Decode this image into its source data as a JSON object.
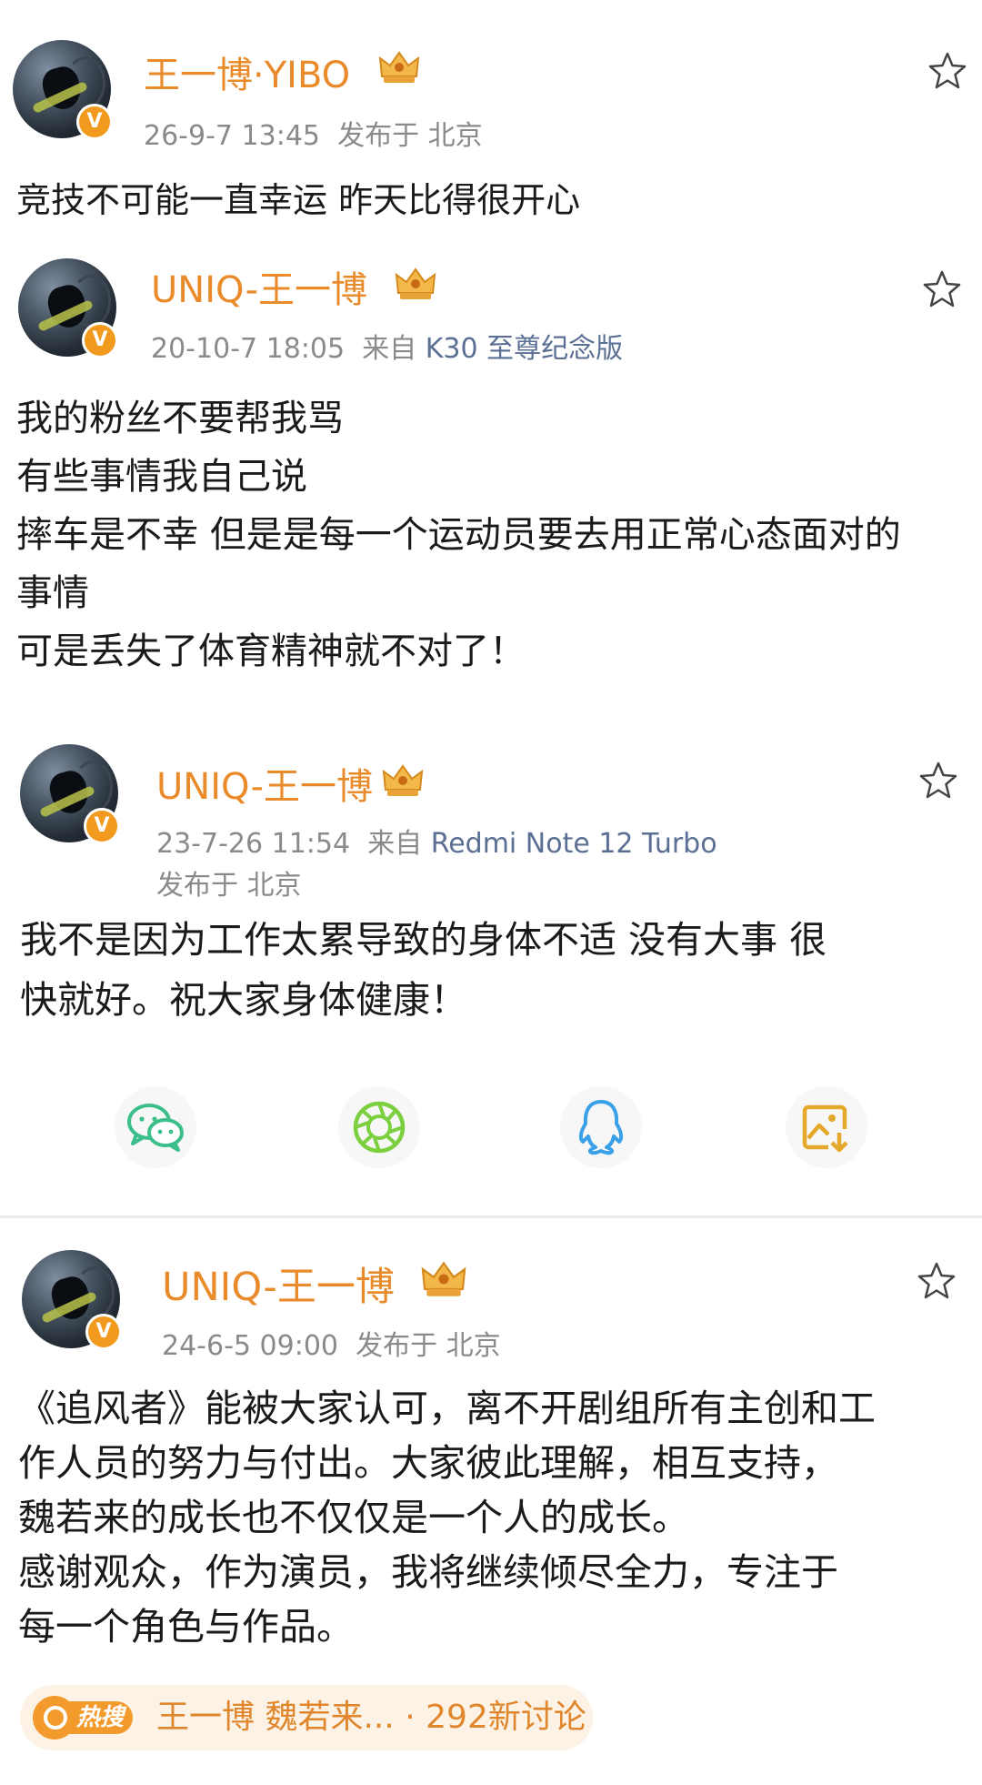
{
  "posts": [
    {
      "username": "王一博·YIBO",
      "time": "26-9-7 13:45",
      "source": "发布于 北京",
      "lines": [
        "竞技不可能一直幸运 昨天比得很开心"
      ]
    },
    {
      "username": "UNIQ-王一博",
      "time": "20-10-7 18:05",
      "source_prefix": "来自",
      "source": "K30 至尊纪念版",
      "lines": [
        "我的粉丝不要帮我骂",
        "有些事情我自己说",
        "摔车是不幸 但是是每一个运动员要去用正常心态面对的",
        "事情",
        "可是丢失了体育精神就不对了！"
      ]
    },
    {
      "username": "UNIQ-王一博",
      "time": "23-7-26 11:54",
      "source_prefix": "来自",
      "source": "Redmi Note 12 Turbo",
      "location": "发布于 北京",
      "lines": [
        "我不是因为工作太累导致的身体不适 没有大事 很",
        "快就好。祝大家身体健康！"
      ]
    },
    {
      "username": "UNIQ-王一博",
      "time": "24-6-5 09:00",
      "source": "发布于 北京",
      "lines": [
        "《追风者》能被大家认可，离不开剧组所有主创和工",
        "作人员的努力与付出。大家彼此理解，相互支持，",
        "魏若来的成长也不仅仅是一个人的成长。",
        "感谢观众，作为演员，我将继续倾尽全力，专注于",
        "每一个角色与作品。"
      ]
    }
  ],
  "share_bar": {
    "icons": [
      "wechat-icon",
      "moments-icon",
      "qq-icon",
      "save-image-icon"
    ],
    "colors": {
      "wechat": "#3cbf8a",
      "moments": "#7ccf3f",
      "qq": "#3aa0e8",
      "save": "#e6a82a"
    }
  },
  "hot_search": {
    "tag": "热搜",
    "text": "王一博 魏若来...",
    "separator": "·",
    "count": "292新讨论"
  },
  "colors": {
    "username": "#e98b2a",
    "meta": "#8a8a8a",
    "verified_badge": "#f29a1d"
  }
}
